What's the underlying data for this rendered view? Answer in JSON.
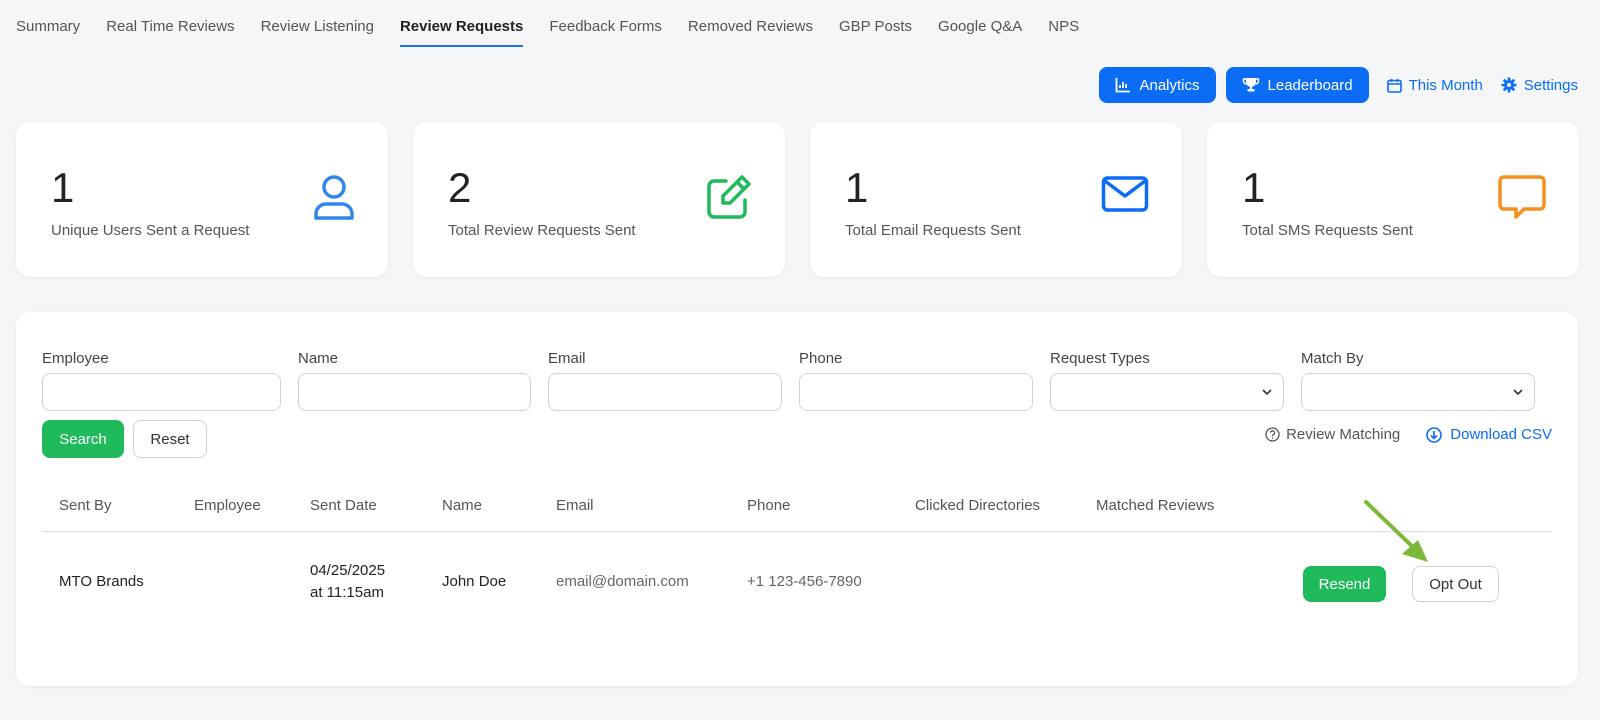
{
  "tabs": [
    {
      "label": "Summary"
    },
    {
      "label": "Real Time Reviews"
    },
    {
      "label": "Review Listening"
    },
    {
      "label": "Review Requests"
    },
    {
      "label": "Feedback Forms"
    },
    {
      "label": "Removed Reviews"
    },
    {
      "label": "GBP Posts"
    },
    {
      "label": "Google Q&A"
    },
    {
      "label": "NPS"
    }
  ],
  "active_tab": "Review Requests",
  "actions": {
    "analytics": "Analytics",
    "leaderboard": "Leaderboard",
    "period": "This Month",
    "settings": "Settings"
  },
  "cards": [
    {
      "value": "1",
      "label": "Unique Users Sent a Request",
      "icon": "user-icon",
      "color": "#2f86eb"
    },
    {
      "value": "2",
      "label": "Total Review Requests Sent",
      "icon": "edit-icon",
      "color": "#1fba5c"
    },
    {
      "value": "1",
      "label": "Total Email Requests Sent",
      "icon": "envelope-icon",
      "color": "#0b6cf5"
    },
    {
      "value": "1",
      "label": "Total SMS Requests Sent",
      "icon": "chat-bubble-icon",
      "color": "#f5901e"
    }
  ],
  "filters": {
    "employee": {
      "label": "Employee",
      "value": ""
    },
    "name": {
      "label": "Name",
      "value": ""
    },
    "email": {
      "label": "Email",
      "value": ""
    },
    "phone": {
      "label": "Phone",
      "value": ""
    },
    "request_types": {
      "label": "Request Types",
      "value": ""
    },
    "match_by": {
      "label": "Match By",
      "value": ""
    }
  },
  "buttons": {
    "search": "Search",
    "reset": "Reset",
    "review_matching": "Review Matching",
    "download_csv": "Download CSV",
    "resend": "Resend",
    "opt_out": "Opt Out"
  },
  "table": {
    "columns": [
      "Sent By",
      "Employee",
      "Sent Date",
      "Name",
      "Email",
      "Phone",
      "Clicked Directories",
      "Matched Reviews"
    ],
    "rows": [
      {
        "sent_by": "MTO Brands",
        "employee": "",
        "sent_date_line1": "04/25/2025",
        "sent_date_line2": "at 11:15am",
        "name": "John Doe",
        "email": "email@domain.com",
        "phone": "+1 123-456-7890",
        "clicked_directories": "",
        "matched_reviews": ""
      }
    ]
  },
  "colors": {
    "primary": "#0b6cf5",
    "success": "#1fba5c",
    "annotation_arrow": "#7cb83a"
  }
}
